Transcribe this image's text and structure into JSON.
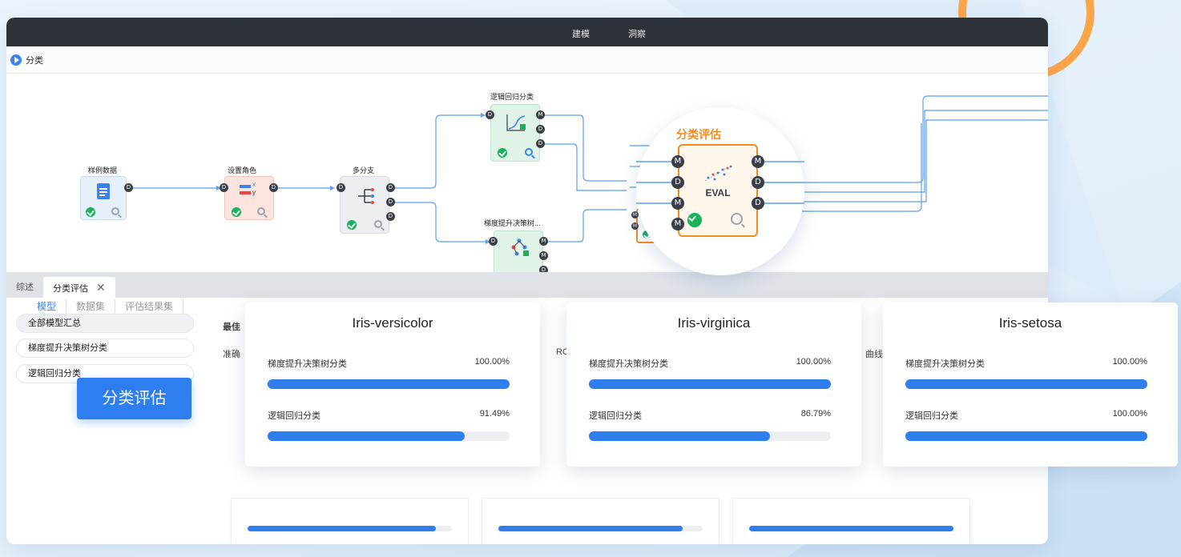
{
  "window": {
    "menu": [
      "建模",
      "洞察"
    ],
    "flow_title": "分类"
  },
  "nodes": {
    "sample_data": "样例数据",
    "set_role": "设置角色",
    "multi_branch": "多分支",
    "logistic": "逻辑回归分类",
    "gbdt": "梯度提升决策树...",
    "eval_title": "分类评估",
    "eval_badge": "EVAL"
  },
  "bottom_tabs": {
    "overview": "综述",
    "eval_tab": "分类评估",
    "close": "✕"
  },
  "subtabs": [
    "模型",
    "数据集",
    "评估结果集"
  ],
  "side_list": [
    "全部模型汇总",
    "梯度提升决策树分类",
    "逻辑回归分类"
  ],
  "floating_button": "分类评估",
  "background_text": {
    "best": "最佳",
    "accuracy": "准确",
    "roc": "RC",
    "curve": "曲线"
  },
  "under_cards": [
    {
      "fill": 0.92
    },
    {
      "fill": 0.9
    },
    {
      "fill": 1.0
    }
  ],
  "cards": [
    {
      "title": "Iris-versicolor",
      "metrics": [
        {
          "name": "梯度提升决策树分类",
          "value": "100.00%",
          "fill": 1.0
        },
        {
          "name": "逻辑回归分类",
          "value": "91.49%",
          "fill": 0.8149
        }
      ]
    },
    {
      "title": "Iris-virginica",
      "metrics": [
        {
          "name": "梯度提升决策树分类",
          "value": "100.00%",
          "fill": 1.0
        },
        {
          "name": "逻辑回归分类",
          "value": "86.79%",
          "fill": 0.7479
        }
      ]
    },
    {
      "title": "Iris-setosa",
      "metrics": [
        {
          "name": "梯度提升决策树分类",
          "value": "100.00%",
          "fill": 1.0
        },
        {
          "name": "逻辑回归分类",
          "value": "100.00%",
          "fill": 1.0
        }
      ]
    }
  ],
  "colors": {
    "accent": "#2f7ef0",
    "eval_orange": "#f58a1f",
    "titlebar": "#2d3138"
  }
}
